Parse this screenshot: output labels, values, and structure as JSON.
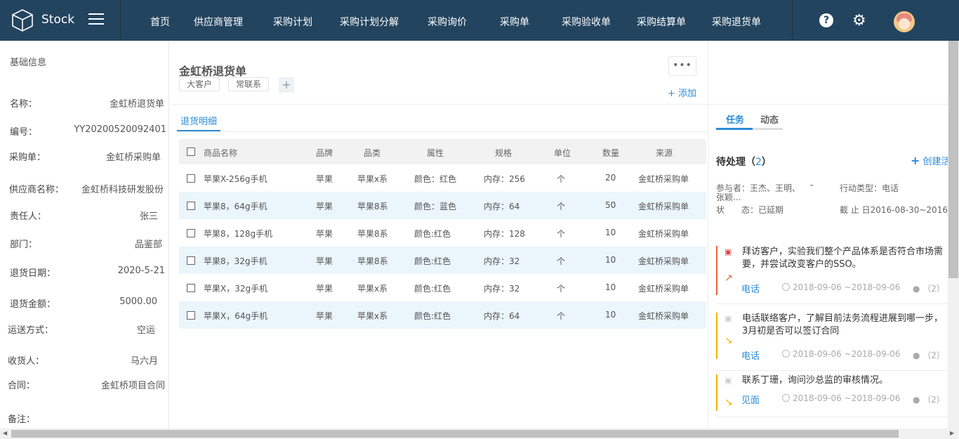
{
  "app": {
    "name": "Stock"
  },
  "nav": [
    "首页",
    "供应商管理",
    "采购计划",
    "采购计划分解",
    "采购询价",
    "采购单",
    "采购验收单",
    "采购结算单",
    "采购退货单"
  ],
  "left": {
    "title": "基础信息",
    "fields": [
      {
        "label": "名称：",
        "value": "金虹桥退货单"
      },
      {
        "label": "编号：",
        "value": "YY20200520092401"
      },
      {
        "label": "采购单：",
        "value": "金虹桥采购单"
      },
      {
        "label": "供应商名称：",
        "value": "金虹桥科技研发股份"
      },
      {
        "label": "责任人：",
        "value": "张三"
      },
      {
        "label": "部门：",
        "value": "品鉴部"
      },
      {
        "label": "退货日期：",
        "value": "2020-5-21"
      },
      {
        "label": "退货金额：",
        "value": "5000.00"
      },
      {
        "label": "运送方式：",
        "value": "空运"
      },
      {
        "label": "收货人：",
        "value": "马六月"
      },
      {
        "label": "合同：",
        "value": "金虹桥项目合同"
      },
      {
        "label": "备注：",
        "value": ""
      }
    ]
  },
  "doc": {
    "title": "金虹桥退货单",
    "tags": [
      "大客户",
      "常联系"
    ],
    "more": "•••",
    "add_link": "+ 添加",
    "tab": "退货明细"
  },
  "table": {
    "headers": [
      "商品名称",
      "品牌",
      "品类",
      "属性",
      "规格",
      "单位",
      "数量",
      "来源"
    ],
    "rows": [
      [
        "苹果X-256g手机",
        "苹果",
        "苹果x系",
        "颜色：红色",
        "内存：256",
        "个",
        "20",
        "金虹桥采购单"
      ],
      [
        "苹果8，64g手机",
        "苹果",
        "苹果8系",
        "颜色：蓝色",
        "内存：64",
        "个",
        "50",
        "金虹桥采购单"
      ],
      [
        "苹果8，128g手机",
        "苹果",
        "苹果8系",
        "颜色:红色",
        "内存：128",
        "个",
        "10",
        "金虹桥采购单"
      ],
      [
        "苹果8，32g手机",
        "苹果",
        "苹果8系",
        "颜色:红色",
        "内存：32",
        "个",
        "10",
        "金虹桥采购单"
      ],
      [
        "苹果X，32g手机",
        "苹果",
        "苹果x系",
        "颜色:红色",
        "内存：32",
        "个",
        "10",
        "金虹桥采购单"
      ],
      [
        "苹果X，64g手机",
        "苹果",
        "苹果x系",
        "颜色:红色",
        "内存：64",
        "个",
        "10",
        "金虹桥采购单"
      ]
    ]
  },
  "right": {
    "tabs": [
      "任务",
      "动态"
    ],
    "pending_label": "待处理（",
    "pending_count": "2",
    "pending_close": "）",
    "create": "创建活",
    "participants": "参与者：王杰、王明、",
    "participants2": "张颖...",
    "action_type": "行动类型：电话",
    "status": "状　　态：已延期",
    "deadline": "截  止  日2016-08-30~2016-0",
    "tasks": [
      {
        "text": "拜访客户，实验我们整个产品体系是否符合市场需要，并尝试改变客户的SSO。",
        "type": "电话",
        "time": "2018-09-06 ~2018-09-06",
        "comments": "（2）",
        "color": "#e8643c"
      },
      {
        "text": "电话联络客户，了解目前法务流程进展到哪一步，3月初是否可以签订合同",
        "type": "电话",
        "time": "2018-09-06 ~2018-09-06",
        "comments": "（2）",
        "color": "#f0b400"
      },
      {
        "text": "联系丁珊，询问沙总监的审核情况。",
        "type": "见面",
        "time": "2018-09-06 ~2018-09-06",
        "comments": "（2）",
        "color": "#f0b400"
      }
    ]
  }
}
